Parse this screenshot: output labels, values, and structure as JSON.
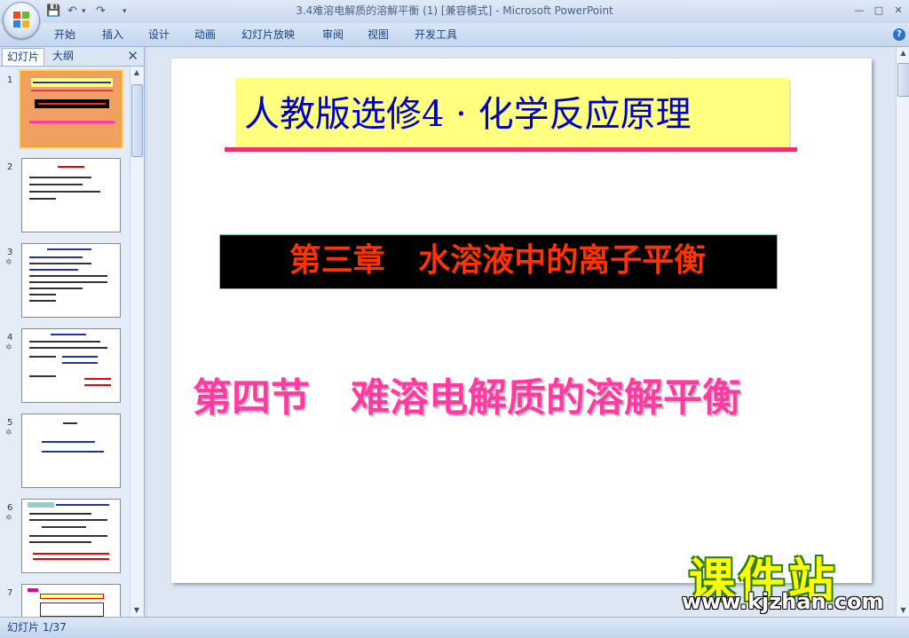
{
  "window": {
    "title": "3.4难溶电解质的溶解平衡 (1) [兼容模式] - Microsoft PowerPoint",
    "min_label": "—",
    "max_label": "□",
    "close_label": "✕"
  },
  "qat": {
    "save": "💾",
    "undo": "↶",
    "redo": "↷",
    "more": "▾"
  },
  "menu": {
    "items": [
      "开始",
      "插入",
      "设计",
      "动画",
      "幻灯片放映",
      "审阅",
      "视图",
      "开发工具"
    ],
    "help": "?"
  },
  "panel": {
    "tab_slides": "幻灯片",
    "tab_outline": "大纲",
    "close": "✕"
  },
  "thumbnails": [
    {
      "num": "1",
      "star": ""
    },
    {
      "num": "2",
      "star": ""
    },
    {
      "num": "3",
      "star": "✲"
    },
    {
      "num": "4",
      "star": "✲"
    },
    {
      "num": "5",
      "star": "✲"
    },
    {
      "num": "6",
      "star": "✲"
    },
    {
      "num": "7",
      "star": ""
    }
  ],
  "slide": {
    "title": "人教版选修4 · 化学反应原理",
    "chapter": "第三章   水溶液中的离子平衡",
    "section": "第四节   难溶电解质的溶解平衡"
  },
  "watermark": {
    "text": "课件站",
    "url": "www.kjzhan.com"
  },
  "status": {
    "slide_indicator": "幻灯片 1/37"
  },
  "colors": {
    "title_bg": "#ffff80",
    "title_fg": "#0000cc",
    "chapter_fg": "#ff3300",
    "section_fg": "#ff3aa3"
  }
}
